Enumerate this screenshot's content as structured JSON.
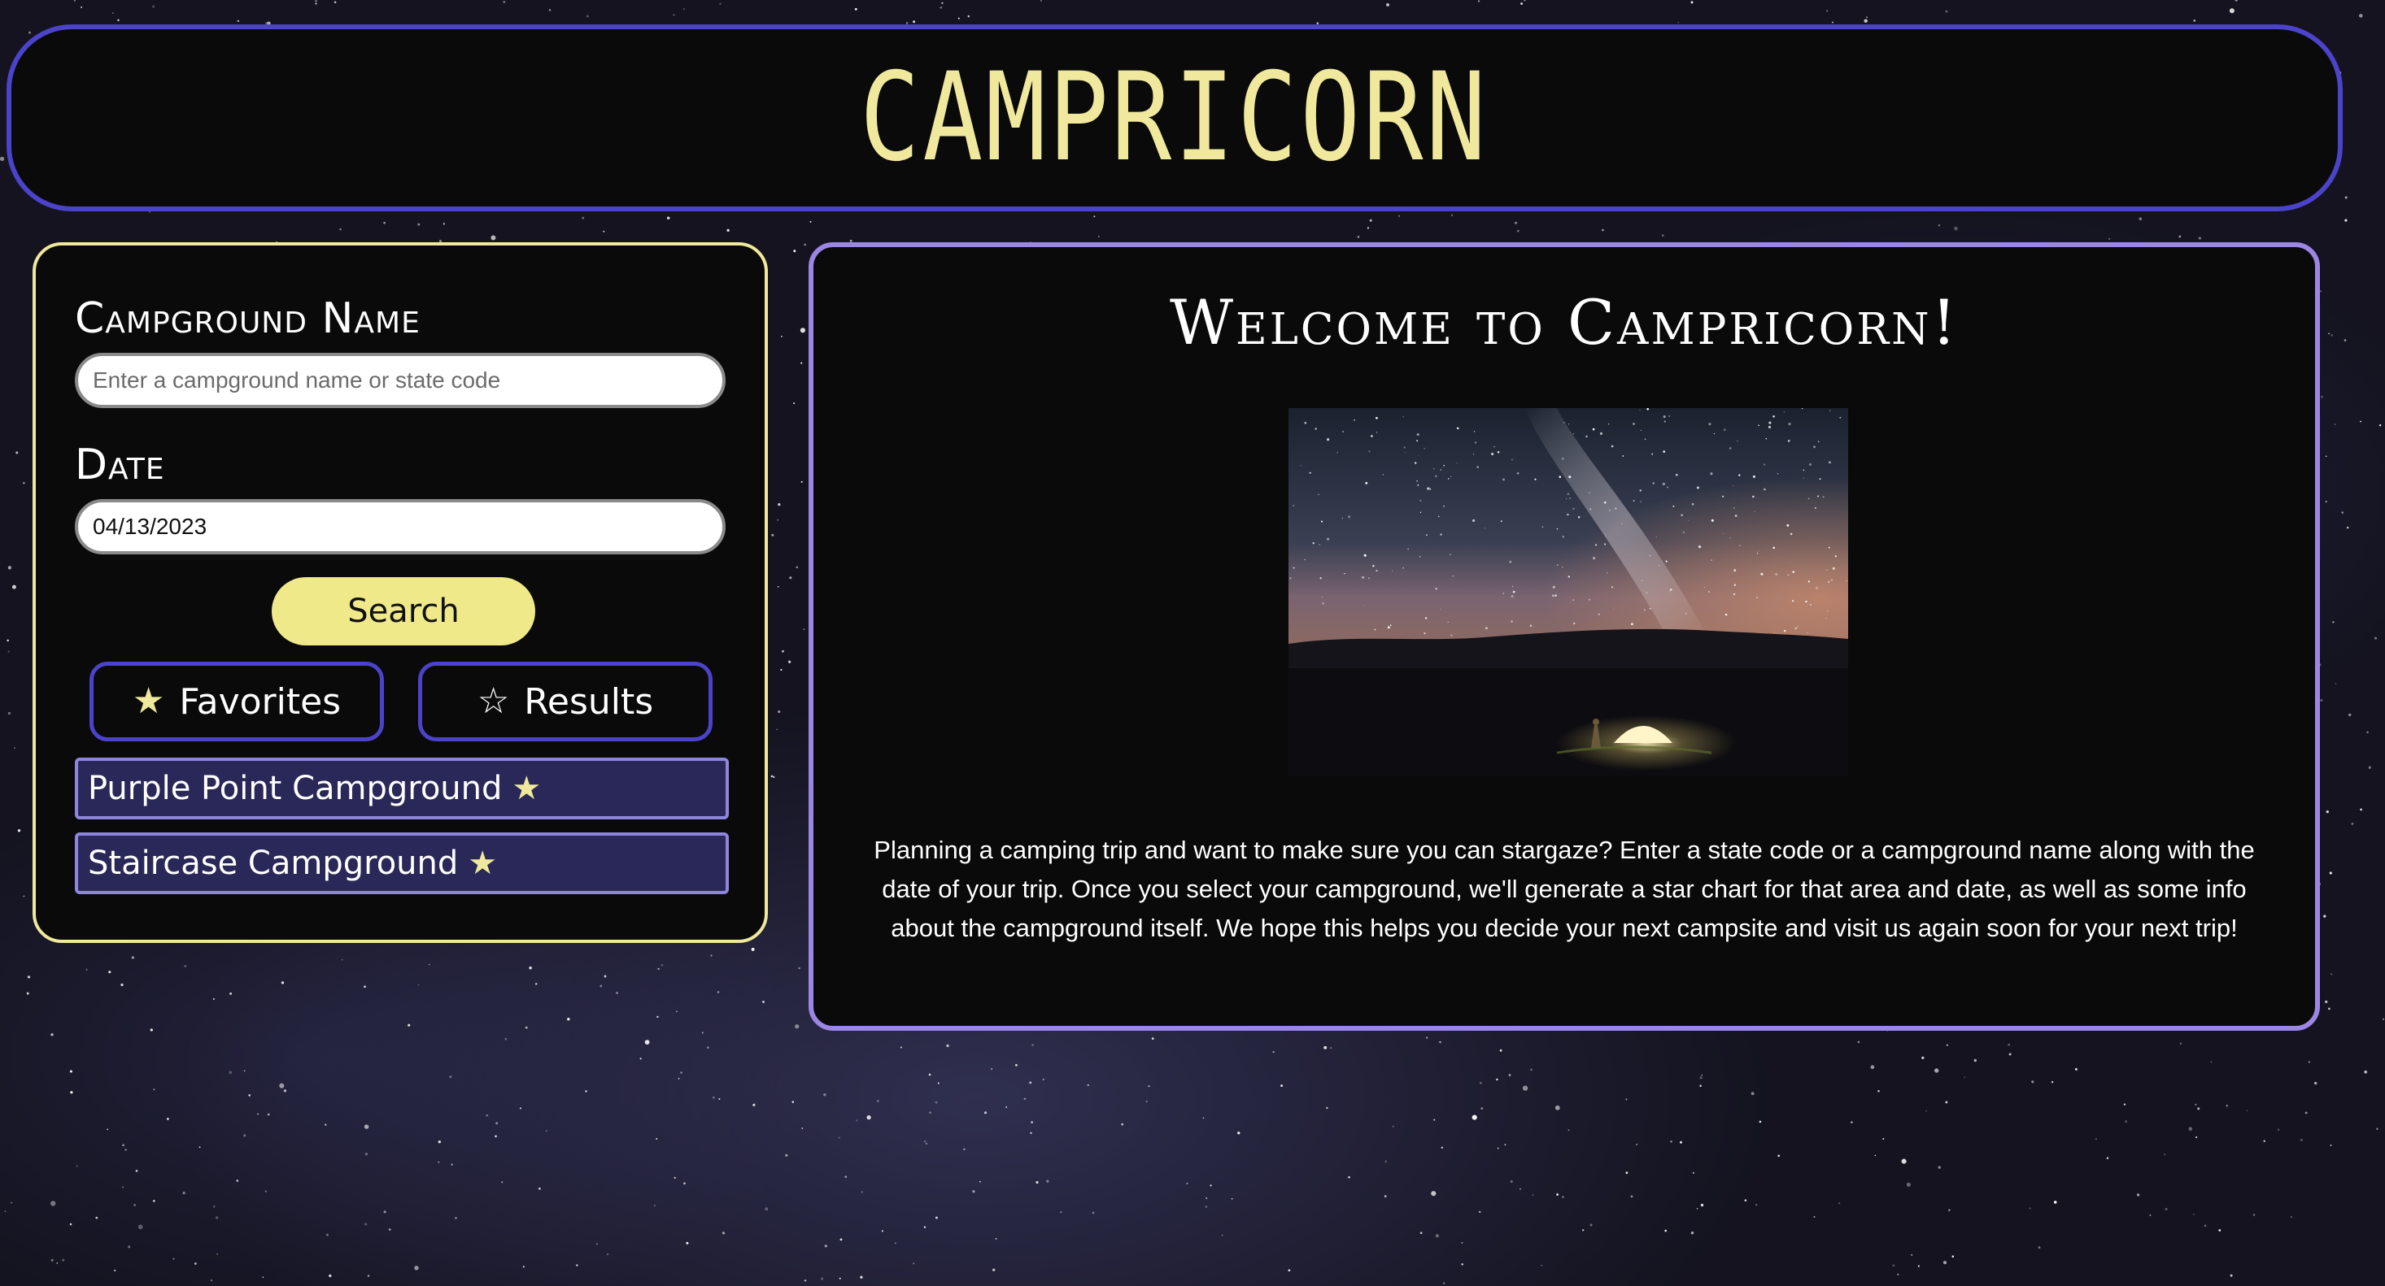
{
  "header": {
    "logo_text": "CAMPRICORN"
  },
  "search_panel": {
    "campground_label": "Campground Name",
    "campground_placeholder": "Enter a campground name or state code",
    "date_label": "Date",
    "date_value": "04/13/2023",
    "search_button": "Search",
    "tabs": [
      {
        "label": "Favorites",
        "icon": "star-filled-icon"
      },
      {
        "label": "Results",
        "icon": "star-outline-icon"
      }
    ],
    "favorites": [
      {
        "name": "Purple Point Campground",
        "icon": "star-filled-icon"
      },
      {
        "name": "Staircase Campground",
        "icon": "star-filled-icon"
      }
    ]
  },
  "main": {
    "title": "Welcome to Campricorn!",
    "intro": "Planning a camping trip and want to make sure you can stargaze? Enter a state code or a campground name along with the date of your trip. Once you select your campground, we'll generate a star chart for that area and date, as well as some info about the campground itself. We hope this helps you decide your next campsite and visit us again soon for your next trip!"
  },
  "colors": {
    "accent_yellow": "#efe89d",
    "accent_blue": "#4b43c9",
    "accent_lavender": "#9b87e3",
    "item_bg": "#292858",
    "panel_bg": "#0a0a0a"
  }
}
